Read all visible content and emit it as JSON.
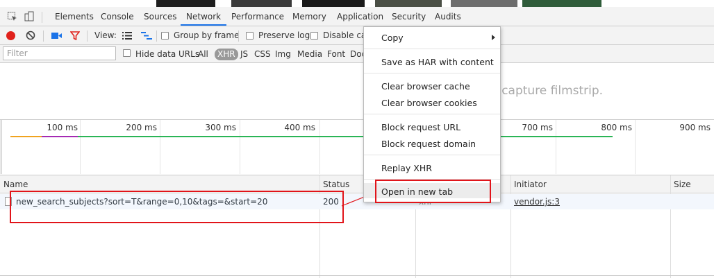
{
  "tabs": {
    "items": [
      "Elements",
      "Console",
      "Sources",
      "Network",
      "Performance",
      "Memory",
      "Application",
      "Security",
      "Audits"
    ],
    "active": "Network"
  },
  "toolbar": {
    "view_label": "View:",
    "group_by_frame": "Group by frame",
    "preserve_log": "Preserve log",
    "disable_cache": "Disable cac"
  },
  "filterbar": {
    "placeholder": "Filter",
    "hide_data_urls": "Hide data URLs",
    "types": [
      "All",
      "XHR",
      "JS",
      "CSS",
      "Img",
      "Media",
      "Font",
      "Doc"
    ],
    "selected_type": "XHR"
  },
  "filmstrip": {
    "message": "d capture filmstrip."
  },
  "timeline": {
    "ticks": [
      "100 ms",
      "200 ms",
      "300 ms",
      "400 ms",
      "700 ms",
      "800 ms",
      "900 ms"
    ]
  },
  "grid": {
    "columns": [
      "Name",
      "Status",
      "Initiator",
      "Size"
    ],
    "rows": [
      {
        "name": "new_search_subjects?sort=T&range=0,10&tags=&start=20",
        "status": "200",
        "type": "xhr",
        "initiator": "vendor.js:3"
      }
    ]
  },
  "context_menu": {
    "items": [
      {
        "label": "Copy",
        "has_submenu": true
      },
      {
        "label": "Save as HAR with content"
      },
      {
        "label": "Clear browser cache"
      },
      {
        "label": "Clear browser cookies"
      },
      {
        "label": "Block request URL"
      },
      {
        "label": "Block request domain"
      },
      {
        "label": "Replay XHR"
      },
      {
        "label": "Open in new tab",
        "highlighted": true
      }
    ]
  },
  "colors": {
    "accent": "#1a73e8",
    "record_red": "#e0211b",
    "annotation_red": "#e1141a",
    "bar_orange": "#f0a31f",
    "bar_purple": "#a52ab3",
    "bar_green": "#2bb556"
  },
  "icons": [
    "inspect-icon",
    "device-toolbar-icon",
    "record-icon",
    "clear-icon",
    "camera-icon",
    "filter-icon",
    "list-view-icon",
    "waterfall-view-icon",
    "submenu-arrow-icon",
    "file-icon"
  ]
}
